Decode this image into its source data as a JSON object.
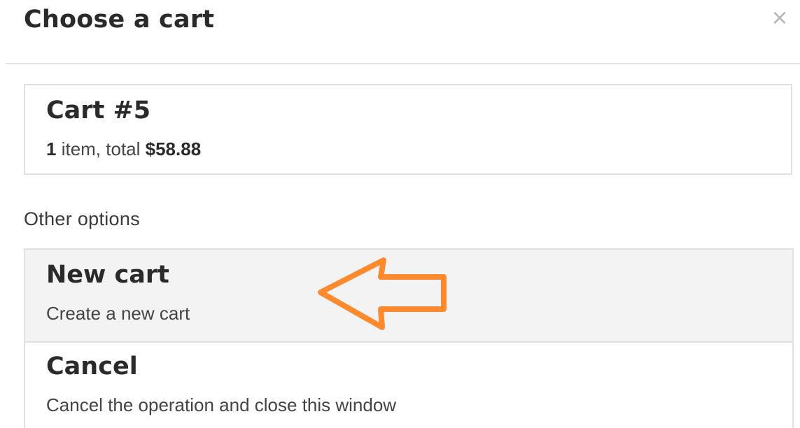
{
  "dialog": {
    "title": "Choose a cart",
    "close_symbol": "×",
    "close_icon": "close-icon"
  },
  "current_cart": {
    "title": "Cart #5",
    "item_count": "1",
    "item_text": " item, total ",
    "total": "$58.88"
  },
  "other_options": {
    "label": "Other options",
    "items": [
      {
        "title": "New cart",
        "description": "Create a new cart",
        "highlighted": true
      },
      {
        "title": "Cancel",
        "description": "Cancel the operation and close this window",
        "highlighted": false
      }
    ]
  },
  "annotation": {
    "icon": "arrow-left-icon",
    "color": "#FF8A2E"
  },
  "colors": {
    "text": "#2a2a2a",
    "border": "#e2e2e2",
    "highlight_bg": "#f3f3f3",
    "close": "#b5b5b5"
  }
}
